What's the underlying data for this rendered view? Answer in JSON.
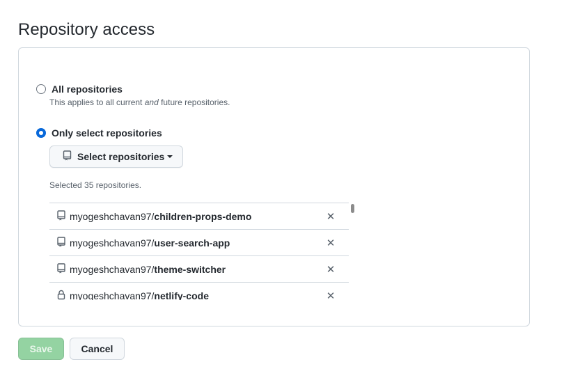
{
  "page": {
    "title": "Repository access"
  },
  "access": {
    "all": {
      "label": "All repositories",
      "note_prefix": "This applies to all current ",
      "note_emphasis": "and",
      "note_suffix": " future repositories.",
      "checked": false
    },
    "only": {
      "label": "Only select repositories",
      "checked": true
    },
    "select_button": {
      "label": "Select repositories",
      "icon": "repo-icon"
    },
    "selected_count": "Selected 35 repositories.",
    "repos": [
      {
        "owner": "myogeshchavan97/",
        "name": "children-props-demo",
        "icon": "repo-icon"
      },
      {
        "owner": "myogeshchavan97/",
        "name": "user-search-app",
        "icon": "repo-icon"
      },
      {
        "owner": "myogeshchavan97/",
        "name": "theme-switcher",
        "icon": "repo-icon"
      },
      {
        "owner": "myogeshchavan97/",
        "name": "netlify-code",
        "icon": "lock-icon"
      }
    ],
    "remove_glyph": "✕"
  },
  "actions": {
    "save_label": "Save",
    "cancel_label": "Cancel"
  },
  "colors": {
    "accent": "#0969da",
    "save_disabled": "#94d3a2"
  }
}
